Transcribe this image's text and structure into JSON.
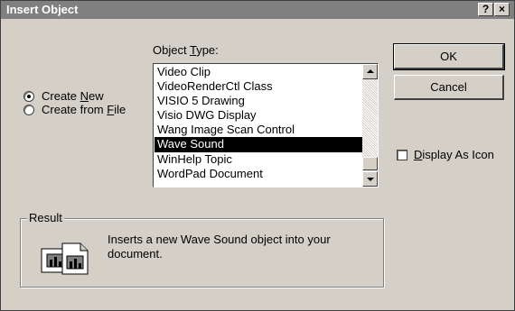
{
  "window": {
    "title": "Insert Object",
    "help_btn": "?",
    "close_btn": "×"
  },
  "options": {
    "create_new": {
      "prefix": "Create ",
      "mnemonic": "N",
      "suffix": "ew",
      "selected": true
    },
    "create_from_file": {
      "prefix": "Create from ",
      "mnemonic": "F",
      "suffix": "ile",
      "selected": false
    }
  },
  "object_type": {
    "label_prefix": "Object ",
    "label_mnemonic": "T",
    "label_suffix": "ype:",
    "items": [
      "Video Clip",
      "VideoRenderCtl Class",
      "VISIO 5 Drawing",
      "Visio DWG Display",
      "Wang Image Scan Control",
      "Wave Sound",
      "WinHelp Topic",
      "WordPad Document"
    ],
    "selected": "Wave Sound"
  },
  "buttons": {
    "ok": "OK",
    "cancel": "Cancel"
  },
  "display_as_icon": {
    "mnemonic": "D",
    "rest": "isplay As Icon",
    "checked": false
  },
  "result": {
    "title": "Result",
    "text": "Inserts a new Wave Sound object into your document."
  }
}
